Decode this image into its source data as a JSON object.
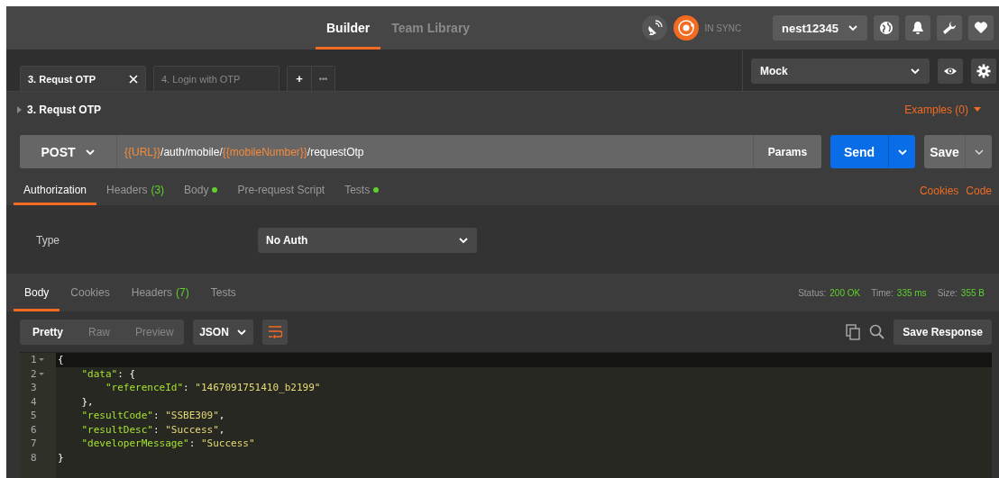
{
  "top_nav": {
    "tabs": [
      {
        "label": "Builder",
        "selected": true
      },
      {
        "label": "Team Library",
        "selected": false
      }
    ],
    "sync_status": "IN SYNC",
    "account": "nest12345"
  },
  "request_tabs": [
    {
      "label": "3. Requst OTP",
      "selected": true
    },
    {
      "label": "4. Login with OTP",
      "selected": false
    }
  ],
  "new_tab": "+",
  "more_tabs": "•••",
  "environment": "Mock",
  "request": {
    "name": "3. Requst OTP",
    "examples": "Examples (0)",
    "method": "POST",
    "url_parts": [
      {
        "text": "{{URL}}",
        "kind": "variable"
      },
      {
        "text": "/auth/mobile/",
        "kind": "plain"
      },
      {
        "text": "{{mobileNumber}}",
        "kind": "variable"
      },
      {
        "text": "/requestOtp",
        "kind": "plain"
      }
    ],
    "params": "Params",
    "send": "Send",
    "save": "Save"
  },
  "request_sections": [
    {
      "label": "Authorization",
      "has_content": false,
      "selected": true
    },
    {
      "label": "Headers",
      "count": "(3)",
      "has_content": false,
      "selected": false
    },
    {
      "label": "Body",
      "has_content": true,
      "selected": false
    },
    {
      "label": "Pre-request Script",
      "has_content": false,
      "selected": false
    },
    {
      "label": "Tests",
      "has_content": true,
      "selected": false
    }
  ],
  "request_links": [
    "Cookies",
    "Code"
  ],
  "auth": {
    "label": "Type",
    "value": "No Auth"
  },
  "response_tabs": [
    {
      "label": "Body",
      "selected": true
    },
    {
      "label": "Cookies",
      "selected": false
    },
    {
      "label": "Headers",
      "count": "(7)",
      "selected": false
    },
    {
      "label": "Tests",
      "selected": false
    }
  ],
  "response_meta": [
    {
      "label": "Status:",
      "value": "200 OK"
    },
    {
      "label": "Time:",
      "value": "335 ms"
    },
    {
      "label": "Size:",
      "value": "355 B"
    }
  ],
  "view_modes": [
    {
      "label": "Pretty",
      "selected": true
    },
    {
      "label": "Raw",
      "selected": false
    },
    {
      "label": "Preview",
      "selected": false
    }
  ],
  "format": "JSON",
  "save_response": "Save Response",
  "code_lines": [
    {
      "number": "1",
      "foldable": true,
      "active": true,
      "text": "{"
    },
    {
      "number": "2",
      "foldable": true,
      "active": false,
      "text": "    \"data\": {"
    },
    {
      "number": "3",
      "foldable": false,
      "active": false,
      "text": "        \"referenceId\": \"1467091751410_b2199\""
    },
    {
      "number": "4",
      "foldable": false,
      "active": false,
      "text": "    },"
    },
    {
      "number": "5",
      "foldable": false,
      "active": false,
      "text": "    \"resultCode\": \"SSBE309\","
    },
    {
      "number": "6",
      "foldable": false,
      "active": false,
      "text": "    \"resultDesc\": \"Success\","
    },
    {
      "number": "7",
      "foldable": false,
      "active": false,
      "text": "    \"developerMessage\": \"Success\""
    },
    {
      "number": "8",
      "foldable": false,
      "active": false,
      "text": "}"
    }
  ]
}
